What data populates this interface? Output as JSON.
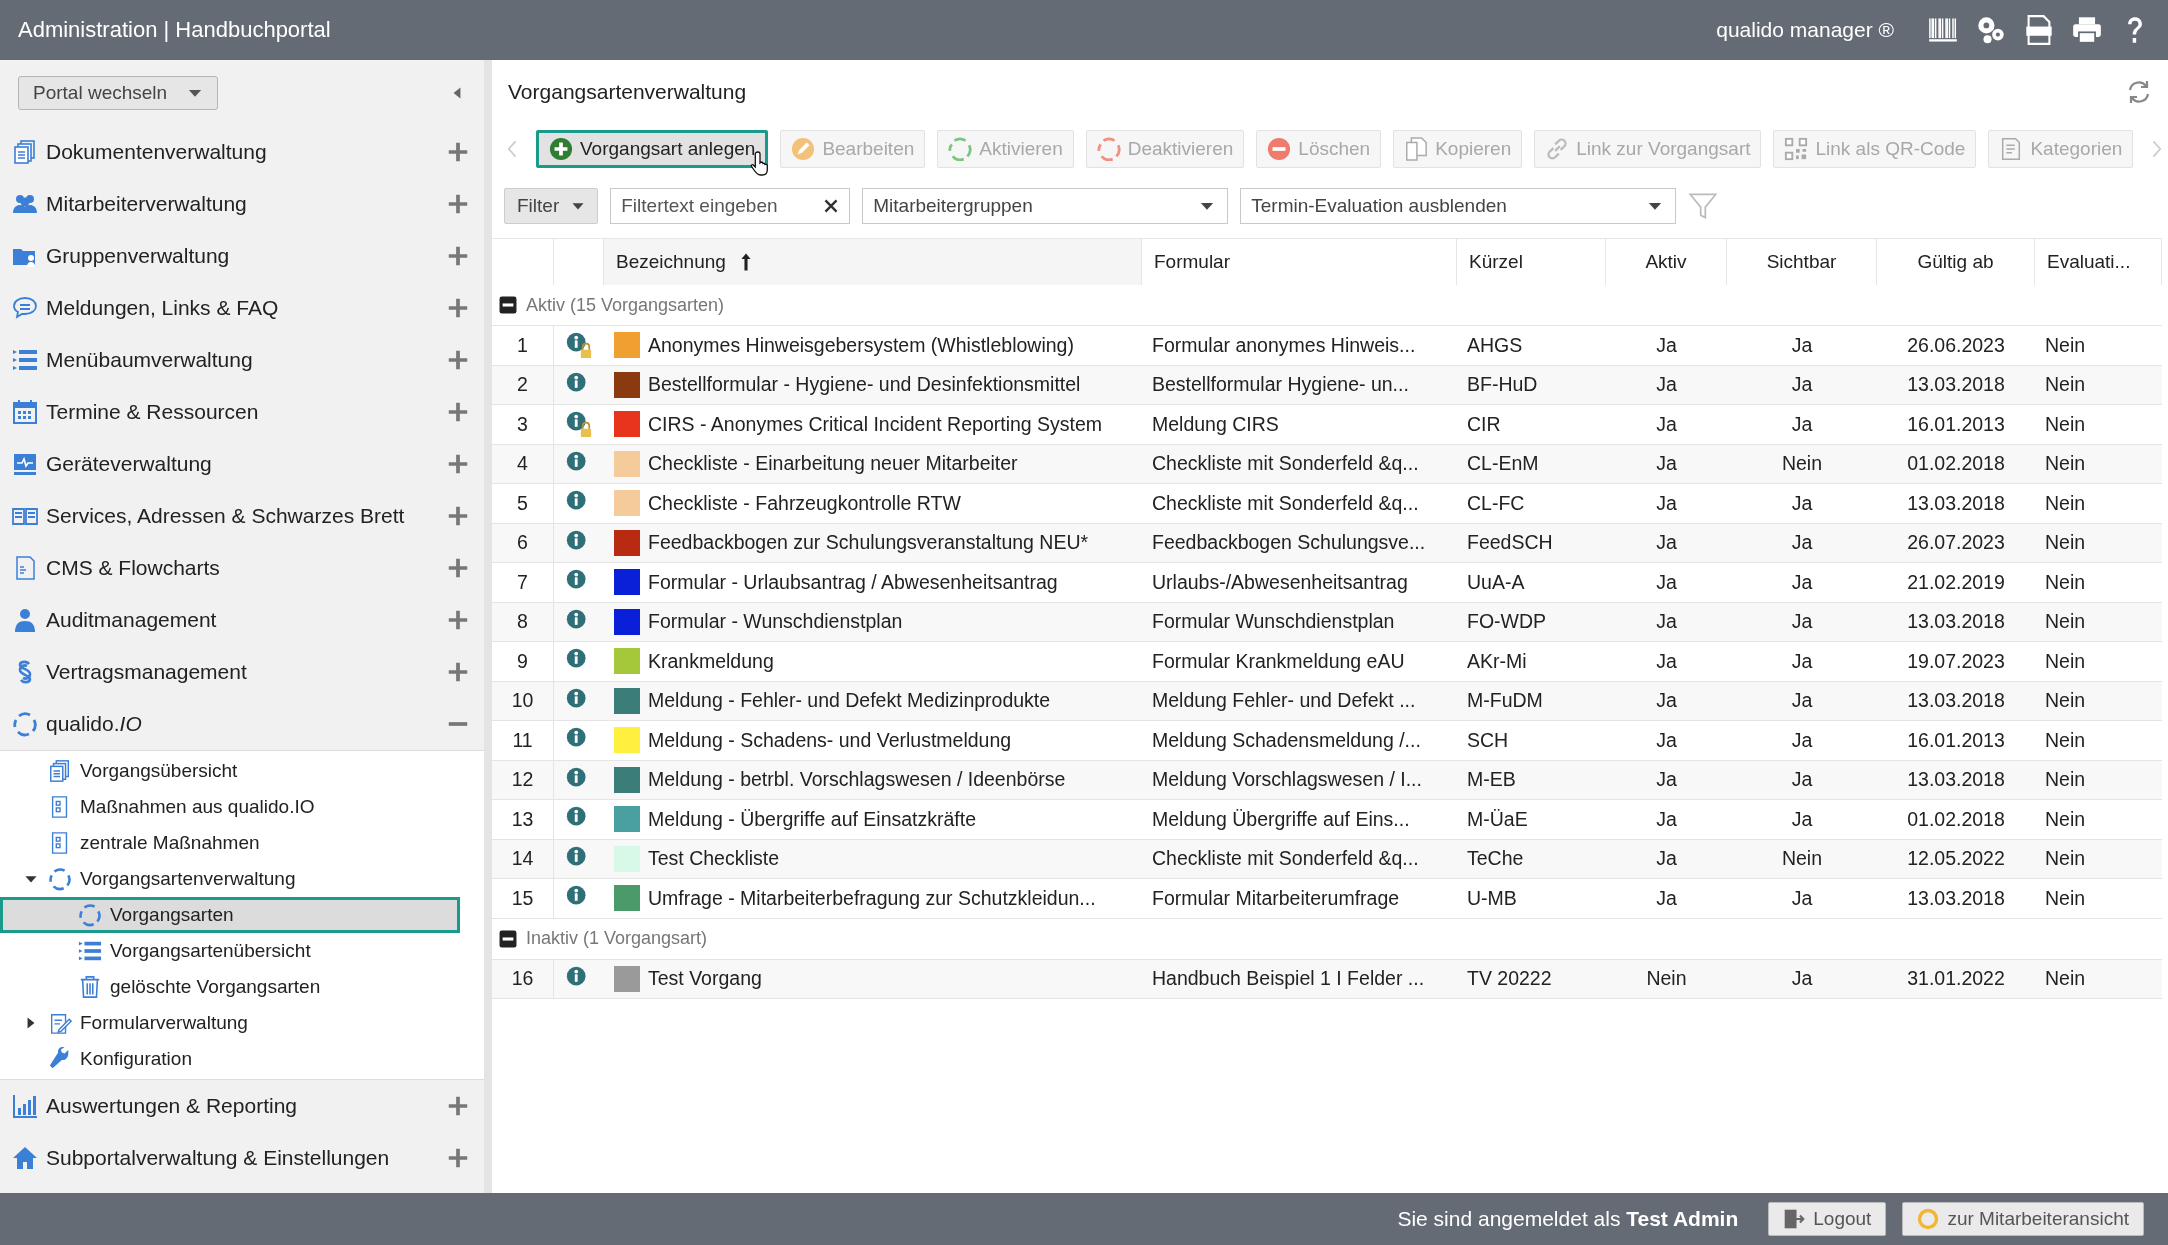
{
  "header": {
    "title": "Administration | Handbuchportal",
    "product": "qualido manager ®"
  },
  "sidebar": {
    "portal_select": {
      "value": "Portal wechseln"
    },
    "sections": [
      {
        "label": "Dokumentenverwaltung",
        "expanded": false
      },
      {
        "label": "Mitarbeiterverwaltung",
        "expanded": false
      },
      {
        "label": "Gruppenverwaltung",
        "expanded": false
      },
      {
        "label": "Meldungen, Links & FAQ",
        "expanded": false
      },
      {
        "label": "Menübaumverwaltung",
        "expanded": false
      },
      {
        "label": "Termine & Ressourcen",
        "expanded": false
      },
      {
        "label": "Geräteverwaltung",
        "expanded": false
      },
      {
        "label": "Services, Adressen & Schwarzes Brett",
        "expanded": false
      },
      {
        "label": "CMS & Flowcharts",
        "expanded": false
      },
      {
        "label": "Auditmanagement",
        "expanded": false
      },
      {
        "label": "Vertragsmanagement",
        "expanded": false
      },
      {
        "label": "qualido.*IO*",
        "expanded": true,
        "children": [
          {
            "label": "Vorgangsübersicht",
            "selected": false
          },
          {
            "label": "Maßnahmen aus qualido.IO",
            "selected": false
          },
          {
            "label": "zentrale Maßnahmen",
            "selected": false
          },
          {
            "label": "Vorgangsartenverwaltung",
            "selected": false,
            "expanded": true,
            "children": [
              {
                "label": "Vorgangsarten",
                "selected": true
              },
              {
                "label": "Vorgangsartenübersicht",
                "selected": false
              },
              {
                "label": "gelöschte Vorgangsarten",
                "selected": false
              }
            ]
          },
          {
            "label": "Formularverwaltung",
            "selected": false,
            "expanded": false
          },
          {
            "label": "Konfiguration",
            "selected": false
          }
        ]
      },
      {
        "label": "Auswertungen & Reporting",
        "expanded": false
      },
      {
        "label": "Subportalverwaltung & Einstellungen",
        "expanded": false
      }
    ]
  },
  "panel": {
    "title": "Vorgangsartenverwaltung"
  },
  "toolbar": [
    {
      "label": "Vorgangsart anlegen",
      "disabled": false
    },
    {
      "label": "Bearbeiten",
      "disabled": true
    },
    {
      "label": "Aktivieren",
      "disabled": true
    },
    {
      "label": "Deaktivieren",
      "disabled": true
    },
    {
      "label": "Löschen",
      "disabled": true
    },
    {
      "label": "Kopieren",
      "disabled": true
    },
    {
      "label": "Link zur Vorgangsart",
      "disabled": true
    },
    {
      "label": "Link als QR-Code",
      "disabled": true
    },
    {
      "label": "Kategorien",
      "disabled": true
    }
  ],
  "filters": {
    "filter_button": "Filter",
    "search": {
      "placeholder": "Filtertext eingeben"
    },
    "group_select": {
      "value": "Mitarbeitergruppen"
    },
    "evaluation_select": {
      "value": "Termin-Evaluation ausblenden"
    }
  },
  "table": {
    "columns": [
      "Bezeichnung",
      "Formular",
      "Kürzel",
      "Aktiv",
      "Sichtbar",
      "Gültig ab",
      "Evaluati..."
    ],
    "groups": [
      {
        "label": "Aktiv (15 Vorgangsarten)",
        "expanded": true,
        "rows": [
          {
            "no": "1",
            "locked": true,
            "color": "#f0a030",
            "name": "Anonymes Hinweisgebersystem (Whistleblowing)",
            "form": "Formular anonymes Hinweis...",
            "code": "AHGS",
            "active": "Ja",
            "visible": "Ja",
            "valid_from": "26.06.2023",
            "evaluation": "Nein"
          },
          {
            "no": "2",
            "locked": false,
            "color": "#8b3a10",
            "name": "Bestellformular - Hygiene- und Desinfektionsmittel",
            "form": "Bestellformular Hygiene- un...",
            "code": "BF-HuD",
            "active": "Ja",
            "visible": "Ja",
            "valid_from": "13.03.2018",
            "evaluation": "Nein"
          },
          {
            "no": "3",
            "locked": true,
            "color": "#e8341c",
            "name": "CIRS - Anonymes Critical Incident Reporting System",
            "form": "Meldung CIRS",
            "code": "CIR",
            "active": "Ja",
            "visible": "Ja",
            "valid_from": "16.01.2013",
            "evaluation": "Nein"
          },
          {
            "no": "4",
            "locked": false,
            "color": "#f5cb9c",
            "name": "Checkliste - Einarbeitung neuer Mitarbeiter",
            "form": "Checkliste mit Sonderfeld &q...",
            "code": "CL-EnM",
            "active": "Ja",
            "visible": "Nein",
            "valid_from": "01.02.2018",
            "evaluation": "Nein"
          },
          {
            "no": "5",
            "locked": false,
            "color": "#f5cb9c",
            "name": "Checkliste - Fahrzeugkontrolle RTW",
            "form": "Checkliste mit Sonderfeld &q...",
            "code": "CL-FC",
            "active": "Ja",
            "visible": "Ja",
            "valid_from": "13.03.2018",
            "evaluation": "Nein"
          },
          {
            "no": "6",
            "locked": false,
            "color": "#b82a12",
            "name": "Feedbackbogen zur Schulungsveranstaltung NEU*",
            "form": "Feedbackbogen Schulungsve...",
            "code": "FeedSCH",
            "active": "Ja",
            "visible": "Ja",
            "valid_from": "26.07.2023",
            "evaluation": "Nein"
          },
          {
            "no": "7",
            "locked": false,
            "color": "#0a1fd8",
            "name": "Formular - Urlaubsantrag / Abwesenheitsantrag",
            "form": "Urlaubs-/Abwesenheitsantrag",
            "code": "UuA-A",
            "active": "Ja",
            "visible": "Ja",
            "valid_from": "21.02.2019",
            "evaluation": "Nein"
          },
          {
            "no": "8",
            "locked": false,
            "color": "#0a1fd8",
            "name": "Formular - Wunschdienstplan",
            "form": "Formular Wunschdienstplan",
            "code": "FO-WDP",
            "active": "Ja",
            "visible": "Ja",
            "valid_from": "13.03.2018",
            "evaluation": "Nein"
          },
          {
            "no": "9",
            "locked": false,
            "color": "#a5c83a",
            "name": "Krankmeldung",
            "form": "Formular Krankmeldung eAU",
            "code": "AKr-Mi",
            "active": "Ja",
            "visible": "Ja",
            "valid_from": "19.07.2023",
            "evaluation": "Nein"
          },
          {
            "no": "10",
            "locked": false,
            "color": "#3b7d78",
            "name": "Meldung - Fehler- und Defekt Medizinprodukte",
            "form": "Meldung Fehler- und Defekt ...",
            "code": "M-FuDM",
            "active": "Ja",
            "visible": "Ja",
            "valid_from": "13.03.2018",
            "evaluation": "Nein"
          },
          {
            "no": "11",
            "locked": false,
            "color": "#fff040",
            "name": "Meldung - Schadens- und Verlustmeldung",
            "form": "Meldung Schadensmeldung /...",
            "code": "SCH",
            "active": "Ja",
            "visible": "Ja",
            "valid_from": "16.01.2013",
            "evaluation": "Nein"
          },
          {
            "no": "12",
            "locked": false,
            "color": "#3b7d78",
            "name": "Meldung - betrbl. Vorschlagswesen / Ideenbörse",
            "form": "Meldung Vorschlagswesen / I...",
            "code": "M-EB",
            "active": "Ja",
            "visible": "Ja",
            "valid_from": "13.03.2018",
            "evaluation": "Nein"
          },
          {
            "no": "13",
            "locked": false,
            "color": "#4aa0a0",
            "name": "Meldung - Übergriffe auf Einsatzkräfte",
            "form": "Meldung Übergriffe auf Eins...",
            "code": "M-ÜaE",
            "active": "Ja",
            "visible": "Ja",
            "valid_from": "01.02.2018",
            "evaluation": "Nein"
          },
          {
            "no": "14",
            "locked": false,
            "color": "#d8f8e8",
            "name": "Test Checkliste",
            "form": "Checkliste mit Sonderfeld &q...",
            "code": "TeChe",
            "active": "Ja",
            "visible": "Nein",
            "valid_from": "12.05.2022",
            "evaluation": "Nein"
          },
          {
            "no": "15",
            "locked": false,
            "color": "#4a9a6a",
            "name": "Umfrage - Mitarbeiterbefragung zur Schutzkleidun...",
            "form": "Formular Mitarbeiterumfrage",
            "code": "U-MB",
            "active": "Ja",
            "visible": "Ja",
            "valid_from": "13.03.2018",
            "evaluation": "Nein"
          }
        ]
      },
      {
        "label": "Inaktiv (1 Vorgangsart)",
        "expanded": true,
        "rows": [
          {
            "no": "16",
            "locked": false,
            "color": "#9a9a9a",
            "name": "Test Vorgang",
            "form": "Handbuch Beispiel 1 I Felder ...",
            "code": "TV 20222",
            "active": "Nein",
            "visible": "Ja",
            "valid_from": "31.01.2022",
            "evaluation": "Nein"
          }
        ]
      }
    ]
  },
  "footer": {
    "login_text": "Sie sind angemeldet als **Test Admin**",
    "logout": "Logout",
    "employee_view": "zur Mitarbeiteransicht"
  }
}
